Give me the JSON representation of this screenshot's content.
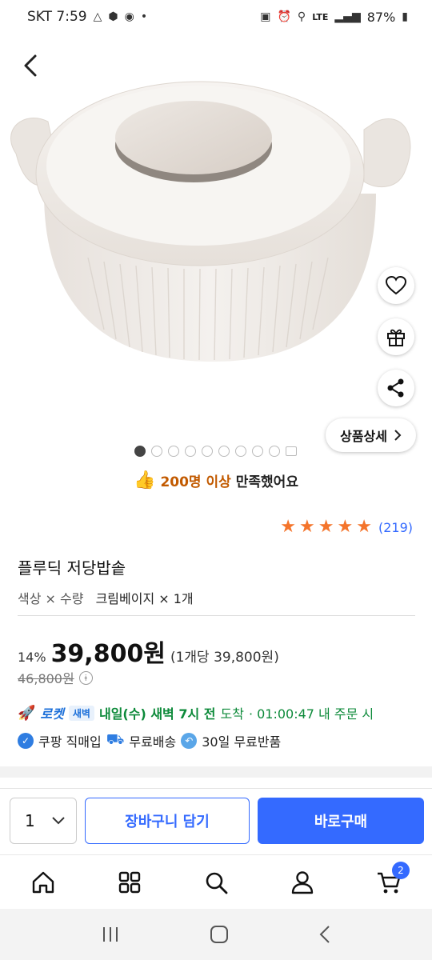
{
  "status_bar": {
    "carrier_time": "SKT 7:59",
    "battery": "87%",
    "network": "LTE"
  },
  "product": {
    "satisfaction_highlight": "200명 이상",
    "satisfaction_rest": "만족했어요",
    "rating_stars": 5,
    "review_count": "(219)",
    "title": "플루딕 저당밥솥",
    "option_label": "색상 × 수량",
    "option_value": "크림베이지 × 1개",
    "discount": "14%",
    "price": "39,800원",
    "unit_price": "(1개당 39,800원)",
    "original_price": "46,800원",
    "detail_button": "상품상세"
  },
  "gallery": {
    "total_dots": 9,
    "active_index": 0
  },
  "delivery": {
    "rocket_label": "로켓",
    "dawn_badge": "새벽",
    "eta": "내일(수) 새벽 7시 전",
    "arrive": "도착",
    "deadline": "· 01:00:47 내 주문 시"
  },
  "features": {
    "direct": "쿠팡 직매입",
    "free_shipping": "무료배송",
    "free_return": "30일 무료반품"
  },
  "purchase": {
    "quantity": "1",
    "cart_label": "장바구니 담기",
    "buy_label": "바로구매"
  },
  "nav": {
    "cart_badge": "2"
  },
  "colors": {
    "accent": "#346aff",
    "star": "#f4742b",
    "green": "#0d8a3a"
  }
}
